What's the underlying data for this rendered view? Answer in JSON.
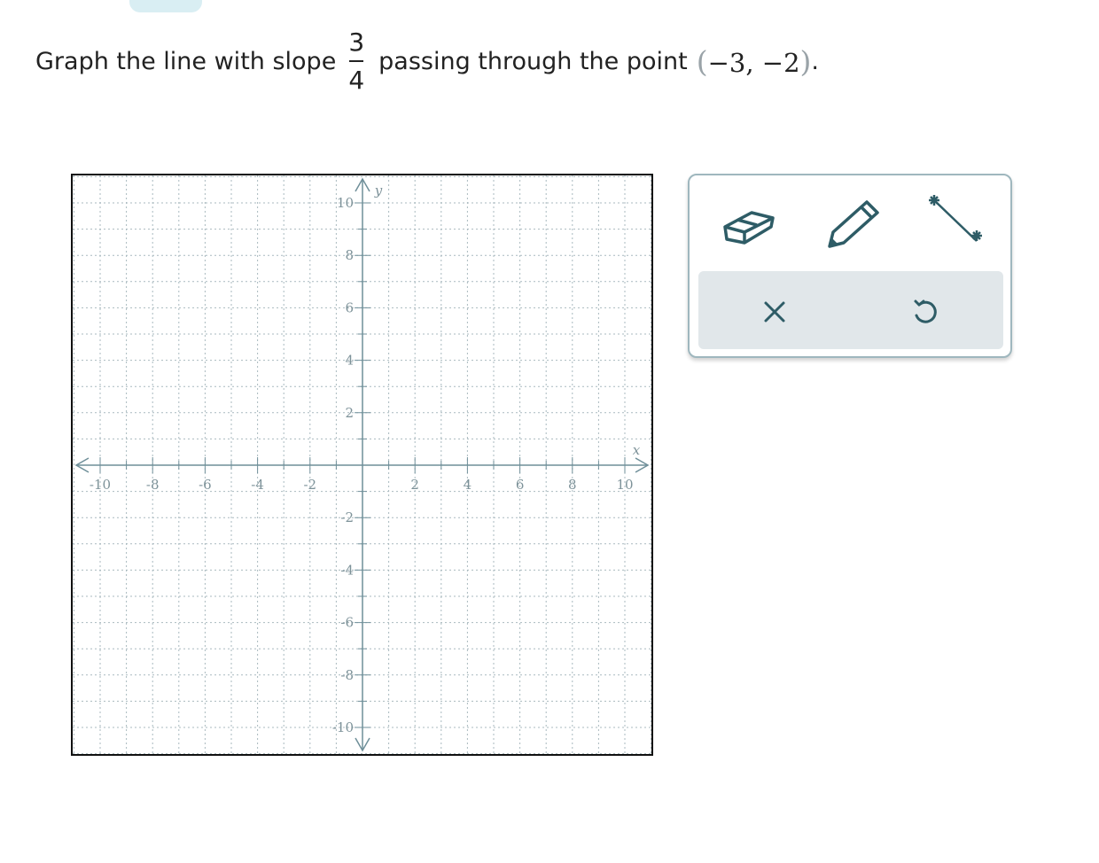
{
  "question": {
    "prefix": "Graph the line with slope",
    "slope_numerator": "3",
    "slope_denominator": "4",
    "middle": "passing through the point",
    "point_open": "(",
    "point_text": "−3, −2",
    "point_close": ")",
    "period": "."
  },
  "graph": {
    "x_label": "x",
    "y_label": "y",
    "x_tick_labels": [
      {
        "value": -10,
        "text": "-10"
      },
      {
        "value": -8,
        "text": "-8"
      },
      {
        "value": -6,
        "text": "-6"
      },
      {
        "value": -4,
        "text": "-4"
      },
      {
        "value": -2,
        "text": "-2"
      },
      {
        "value": 2,
        "text": "2"
      },
      {
        "value": 4,
        "text": "4"
      },
      {
        "value": 6,
        "text": "6"
      },
      {
        "value": 8,
        "text": "8"
      },
      {
        "value": 10,
        "text": "10"
      }
    ],
    "y_tick_labels": [
      {
        "value": 10,
        "text": "10"
      },
      {
        "value": 8,
        "text": "8"
      },
      {
        "value": 6,
        "text": "6"
      },
      {
        "value": 4,
        "text": "4"
      },
      {
        "value": 2,
        "text": "2"
      },
      {
        "value": -2,
        "text": "-2"
      },
      {
        "value": -4,
        "text": "-4"
      },
      {
        "value": -6,
        "text": "-6"
      },
      {
        "value": -8,
        "text": "-8"
      },
      {
        "value": -10,
        "text": "-10"
      }
    ],
    "axis_color": "#6f8f99",
    "grid_color": "#a9b9bf",
    "label_color": "#7d9299"
  },
  "toolbar": {
    "tools": [
      {
        "name": "eraser-tool",
        "icon": "eraser-icon"
      },
      {
        "name": "pencil-tool",
        "icon": "pencil-icon"
      },
      {
        "name": "line-tool",
        "icon": "line-segment-icon"
      }
    ],
    "actions": [
      {
        "name": "clear-button",
        "icon": "close-icon"
      },
      {
        "name": "undo-button",
        "icon": "undo-icon"
      }
    ],
    "icon_color": "#2e5c66"
  }
}
